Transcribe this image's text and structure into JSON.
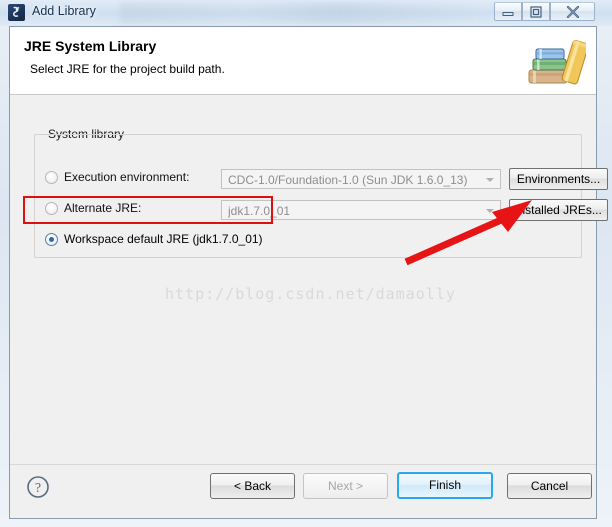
{
  "window": {
    "title": "Add Library",
    "app_icon": "library-app-icon",
    "controls": {
      "minimize": "minimize-icon",
      "maximize": "restore-icon",
      "close": "close-icon"
    }
  },
  "header": {
    "title": "JRE System Library",
    "subtitle": "Select JRE for the project build path.",
    "icon": "books-stack-icon"
  },
  "group": {
    "label": "System library",
    "rows": [
      {
        "radio_label": "Execution environment:",
        "selected": false,
        "combo_value": "CDC-1.0/Foundation-1.0 (Sun JDK 1.6.0_13)",
        "button_label": "Environments..."
      },
      {
        "radio_label": "Alternate JRE:",
        "selected": false,
        "combo_value": "jdk1.7.0_01",
        "button_label": "Installed JREs..."
      },
      {
        "radio_label": "Workspace default JRE (jdk1.7.0_01)",
        "selected": true
      }
    ]
  },
  "annotations": {
    "highlight_color": "#e10e0e",
    "rect_target": "workspace-default-jre-radio",
    "arrow_target": "installed-jres-button"
  },
  "watermark": {
    "text": "http://blog.csdn.net/damaolly"
  },
  "footer": {
    "help_icon": "help-question-icon",
    "back_label": "< Back",
    "next_label": "Next >",
    "finish_label": "Finish",
    "cancel_label": "Cancel",
    "default_button_color": "#2aa8e8"
  }
}
